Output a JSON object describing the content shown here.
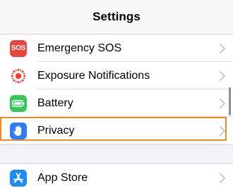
{
  "header": {
    "title": "Settings"
  },
  "settings": {
    "group1": [
      {
        "label": "Emergency SOS",
        "icon": "sos-icon",
        "icon_text": "SOS",
        "color": "#e8453c"
      },
      {
        "label": "Exposure Notifications",
        "icon": "exposure-notifications-icon",
        "color": "#ff3b30"
      },
      {
        "label": "Battery",
        "icon": "battery-icon",
        "color": "#34c759"
      },
      {
        "label": "Privacy",
        "icon": "hand-icon",
        "color": "#2f7cf6"
      }
    ],
    "group2": [
      {
        "label": "App Store",
        "icon": "app-store-icon",
        "color": "#1a8cf5"
      }
    ]
  },
  "colors": {
    "highlight": "#f08a24",
    "chevron": "#c4c4c7"
  }
}
